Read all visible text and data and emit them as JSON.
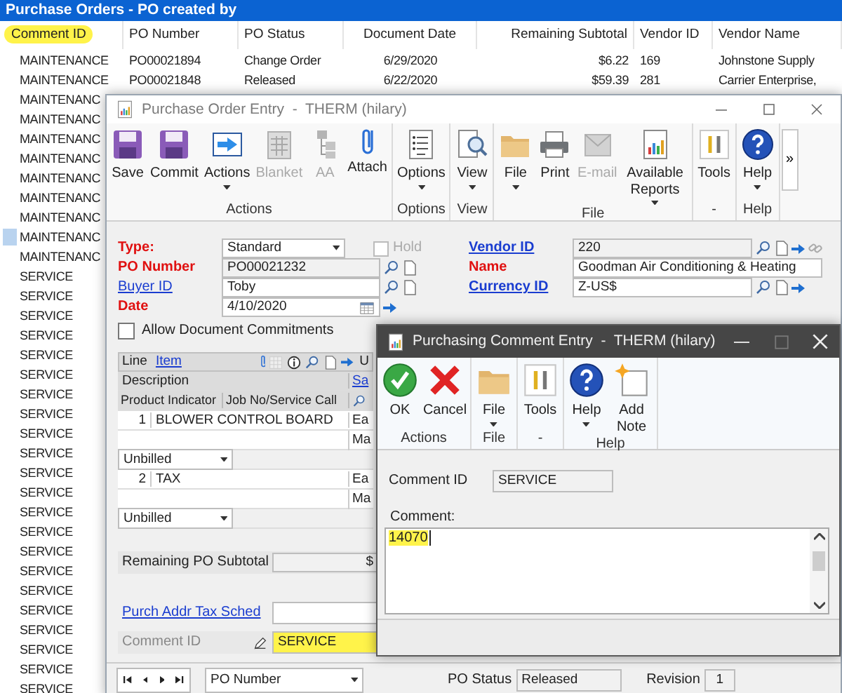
{
  "list": {
    "title": "Purchase Orders - PO created by",
    "columns": [
      {
        "label": "Comment ID",
        "highlighted": true
      },
      {
        "label": "PO Number",
        "highlighted": false
      },
      {
        "label": "PO Status",
        "highlighted": false
      },
      {
        "label": "Document Date",
        "highlighted": false
      },
      {
        "label": "Remaining Subtotal",
        "highlighted": false
      },
      {
        "label": "Vendor ID",
        "highlighted": false
      },
      {
        "label": "Vendor Name",
        "highlighted": false
      }
    ],
    "rows": [
      {
        "cells": [
          "MAINTENANCE",
          "PO00021894",
          "Change Order",
          "6/29/2020",
          "$6.22",
          "169",
          "Johnstone Supply"
        ],
        "selected": false
      },
      {
        "cells": [
          "MAINTENANCE",
          "PO00021848",
          "Released",
          "6/22/2020",
          "$59.39",
          "281",
          "Carrier Enterprise,"
        ],
        "selected": false
      },
      {
        "cells": [
          "MAINTENANC"
        ],
        "selected": false
      },
      {
        "cells": [
          "MAINTENANC"
        ],
        "selected": false
      },
      {
        "cells": [
          "MAINTENANC"
        ],
        "selected": false
      },
      {
        "cells": [
          "MAINTENANC"
        ],
        "selected": false
      },
      {
        "cells": [
          "MAINTENANC"
        ],
        "selected": false
      },
      {
        "cells": [
          "MAINTENANC"
        ],
        "selected": false
      },
      {
        "cells": [
          "MAINTENANC"
        ],
        "selected": false
      },
      {
        "cells": [
          "MAINTENANC"
        ],
        "selected": true
      },
      {
        "cells": [
          "MAINTENANC"
        ],
        "selected": false
      },
      {
        "cells": [
          "SERVICE"
        ],
        "selected": false
      },
      {
        "cells": [
          "SERVICE"
        ],
        "selected": false
      },
      {
        "cells": [
          "SERVICE"
        ],
        "selected": false
      },
      {
        "cells": [
          "SERVICE"
        ],
        "selected": false
      },
      {
        "cells": [
          "SERVICE"
        ],
        "selected": false
      },
      {
        "cells": [
          "SERVICE"
        ],
        "selected": false
      },
      {
        "cells": [
          "SERVICE"
        ],
        "selected": false
      },
      {
        "cells": [
          "SERVICE"
        ],
        "selected": false
      },
      {
        "cells": [
          "SERVICE"
        ],
        "selected": false
      },
      {
        "cells": [
          "SERVICE"
        ],
        "selected": false
      },
      {
        "cells": [
          "SERVICE"
        ],
        "selected": false
      },
      {
        "cells": [
          "SERVICE"
        ],
        "selected": false
      },
      {
        "cells": [
          "SERVICE"
        ],
        "selected": false
      },
      {
        "cells": [
          "SERVICE"
        ],
        "selected": false
      },
      {
        "cells": [
          "SERVICE"
        ],
        "selected": false
      },
      {
        "cells": [
          "SERVICE"
        ],
        "selected": false
      },
      {
        "cells": [
          "SERVICE"
        ],
        "selected": false
      },
      {
        "cells": [
          "SERVICE"
        ],
        "selected": false
      },
      {
        "cells": [
          "SERVICE"
        ],
        "selected": false
      },
      {
        "cells": [
          "SERVICE"
        ],
        "selected": false
      },
      {
        "cells": [
          "SERVICE"
        ],
        "selected": false
      },
      {
        "cells": [
          "SERVICE"
        ],
        "selected": false
      }
    ]
  },
  "po_window": {
    "title": "Purchase Order Entry  -  THERM (hilary)",
    "ribbon": [
      {
        "label": "Actions",
        "buttons": [
          {
            "label": "Save",
            "kind": "floppy",
            "disabled": false,
            "menu": false
          },
          {
            "label": "Commit",
            "kind": "floppy",
            "disabled": false,
            "menu": false
          },
          {
            "label": "Actions",
            "kind": "actions",
            "disabled": false,
            "menu": true
          },
          {
            "label": "Blanket",
            "kind": "blanket",
            "disabled": true,
            "menu": false
          },
          {
            "label": "AA",
            "kind": "tree",
            "disabled": true,
            "menu": false
          },
          {
            "label": "Attach",
            "kind": "attach",
            "disabled": false,
            "menu": false
          }
        ]
      },
      {
        "label": "Options",
        "buttons": [
          {
            "label": "Options",
            "kind": "options",
            "disabled": false,
            "menu": true
          }
        ]
      },
      {
        "label": "View",
        "buttons": [
          {
            "label": "View",
            "kind": "view",
            "disabled": false,
            "menu": true
          }
        ]
      },
      {
        "label": "File",
        "buttons": [
          {
            "label": "File",
            "kind": "folder",
            "disabled": false,
            "menu": true
          },
          {
            "label": "Print",
            "kind": "print",
            "disabled": false,
            "menu": false
          },
          {
            "label": "E-mail",
            "kind": "email",
            "disabled": true,
            "menu": false
          },
          {
            "label": "Available Reports",
            "kind": "reports",
            "disabled": false,
            "menu": true
          }
        ]
      },
      {
        "label": "-",
        "buttons": [
          {
            "label": "Tools",
            "kind": "tools",
            "disabled": false,
            "menu": false
          }
        ]
      },
      {
        "label": "Help",
        "buttons": [
          {
            "label": "Help",
            "kind": "help",
            "disabled": false,
            "menu": true
          }
        ]
      }
    ],
    "overflow": "»",
    "header_left": [
      {
        "label": "Type:",
        "required": true,
        "link": false,
        "value": "Standard",
        "kind": "select",
        "checkbox": {
          "label": "Hold",
          "checked": false,
          "disabled": true
        }
      },
      {
        "label": "PO Number",
        "required": true,
        "link": false,
        "value": "PO00021232",
        "kind": "readonly",
        "lookup": true,
        "note": true
      },
      {
        "label": "Buyer ID",
        "required": false,
        "link": true,
        "value": "Toby",
        "kind": "input",
        "lookup": true,
        "note": true
      },
      {
        "label": "Date",
        "required": true,
        "link": false,
        "value": "4/10/2020",
        "kind": "date",
        "go": true
      }
    ],
    "header_right": [
      {
        "label": "Vendor ID",
        "required": true,
        "link": true,
        "value": "220",
        "kind": "readonly",
        "lookup": true,
        "note": true,
        "go": true,
        "chain": true
      },
      {
        "label": "Name",
        "required": true,
        "link": false,
        "value": "Goodman Air Conditioning & Heating",
        "kind": "wide"
      },
      {
        "label": "Currency ID",
        "required": true,
        "link": true,
        "value": "Z-US$",
        "kind": "input",
        "lookup": true,
        "note": true,
        "go": true
      }
    ],
    "allow_commitments": {
      "label": "Allow Document Commitments",
      "checked": false
    },
    "grid": {
      "tabs": [
        {
          "label": "Line",
          "kind": "text"
        },
        {
          "label": "Item",
          "kind": "link"
        }
      ],
      "edge_label": "U",
      "description": "Description",
      "edge_link": "Sa",
      "columns": [
        "Product Indicator",
        "Job No/Service Call"
      ],
      "lines": [
        {
          "number": "1",
          "description": "BLOWER CONTROL BOARD",
          "edge_top": "Ea",
          "edge_bottom": "Ma",
          "indicator": "Unbilled"
        },
        {
          "number": "2",
          "description": "TAX",
          "edge_top": "Ea",
          "edge_bottom": "Ma",
          "indicator": "Unbilled"
        }
      ]
    },
    "remaining_subtotal": {
      "label": "Remaining PO Subtotal",
      "value": "$"
    },
    "tax_schedule": {
      "label": "Purch Addr Tax Sched"
    },
    "comment_id": {
      "label": "Comment ID",
      "value": "SERVICE",
      "highlighted": true
    },
    "browse_by": "PO Number",
    "status": {
      "label": "PO Status",
      "value": "Released"
    },
    "revision": {
      "label": "Revision",
      "value": "1"
    }
  },
  "comment_window": {
    "title": "Purchasing Comment Entry  -  THERM (hilary)",
    "ribbon": [
      {
        "label": "Actions",
        "buttons": [
          {
            "label": "OK",
            "kind": "ok",
            "disabled": false,
            "menu": false
          },
          {
            "label": "Cancel",
            "kind": "cancel",
            "disabled": false,
            "menu": false
          }
        ]
      },
      {
        "label": "File",
        "buttons": [
          {
            "label": "File",
            "kind": "folder",
            "disabled": false,
            "menu": true
          }
        ]
      },
      {
        "label": "-",
        "buttons": [
          {
            "label": "Tools",
            "kind": "tools",
            "disabled": false,
            "menu": false
          }
        ]
      },
      {
        "label": "Help",
        "buttons": [
          {
            "label": "Help",
            "kind": "help",
            "disabled": false,
            "menu": true
          },
          {
            "label": "Add Note",
            "kind": "note",
            "disabled": false,
            "menu": false
          }
        ]
      }
    ],
    "comment_id": {
      "label": "Comment ID",
      "value": "SERVICE"
    },
    "comment": {
      "label": "Comment:",
      "value": "14070",
      "highlighted": true
    }
  }
}
